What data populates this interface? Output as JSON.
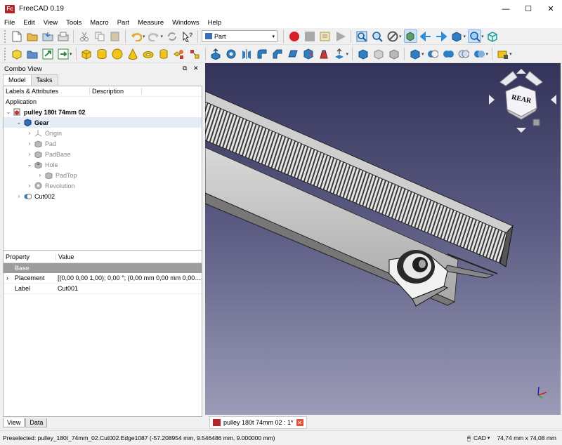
{
  "window": {
    "title": "FreeCAD 0.19",
    "app_icon_text": "Fc",
    "minimize": "—",
    "maximize": "☐",
    "close": "✕"
  },
  "menu": [
    "File",
    "Edit",
    "View",
    "Tools",
    "Macro",
    "Part",
    "Measure",
    "Windows",
    "Help"
  ],
  "toolbar": {
    "workbench": "Part"
  },
  "combo_view": {
    "title": "Combo View",
    "tabs": [
      "Model",
      "Tasks"
    ],
    "tree_columns": [
      "Labels & Attributes",
      "Description"
    ],
    "section": "Application",
    "tree": [
      {
        "label": "pulley 180t 74mm 02",
        "bold": true
      },
      {
        "label": "Gear",
        "bold": true
      },
      {
        "label": "Origin"
      },
      {
        "label": "Pad"
      },
      {
        "label": "PadBase"
      },
      {
        "label": "Hole"
      },
      {
        "label": "PadTop"
      },
      {
        "label": "Revolution"
      },
      {
        "label": "Cut002"
      }
    ],
    "property_columns": [
      "Property",
      "Value"
    ],
    "property_group": "Base",
    "properties": [
      {
        "name": "Placement",
        "value": "[(0,00 0,00 1,00); 0,00 °; (0,00 mm  0,00 mm  0,00 ..."
      },
      {
        "name": "Label",
        "value": "Cut001"
      }
    ],
    "bottom_tabs": [
      "View",
      "Data"
    ]
  },
  "view3d": {
    "navcube_face": "REAR",
    "doc_tab": "pulley 180t 74mm 02 : 1*"
  },
  "status": {
    "message": "Preselected: pulley_180t_74mm_02.Cut002.Edge1087 (-57.208954 mm, 9.546486 mm, 9.000000 mm)",
    "nav_style": "CAD",
    "dimensions": "74,74 mm x 74,08 mm"
  }
}
